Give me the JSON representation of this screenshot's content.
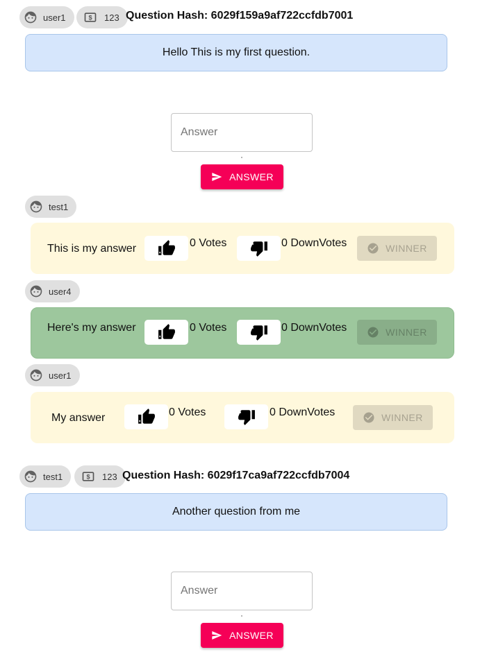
{
  "questions": [
    {
      "user": "user1",
      "dollars": "123",
      "hash": "Question Hash: 6029f159a9af722ccfdb7001",
      "text": "Hello This is my first question.",
      "answer_placeholder": "Answer",
      "answer_button": "ANSWER",
      "answers": [
        {
          "user": "test1",
          "text": "This is my answer",
          "votes": "0 Votes",
          "downvotes": "0 DownVotes",
          "winner": "WINNER",
          "highlighted": false
        },
        {
          "user": "user4",
          "text": "Here's my answer",
          "votes": "0 Votes",
          "downvotes": "0 DownVotes",
          "winner": "WINNER",
          "highlighted": true
        },
        {
          "user": "user1",
          "text": "My answer",
          "votes": "0 Votes",
          "downvotes": "0 DownVotes",
          "winner": "WINNER",
          "highlighted": false
        }
      ]
    },
    {
      "user": "test1",
      "dollars": "123",
      "hash": "Question Hash: 6029f17ca9af722ccfdb7004",
      "text": "Another question from me",
      "answer_placeholder": "Answer",
      "answer_button": "ANSWER",
      "answers": []
    }
  ],
  "icons": {
    "avatar": "face-icon",
    "money": "dollar-box-icon",
    "send": "send-icon",
    "upvote": "thumb-up-icon",
    "downvote": "thumb-down-icon",
    "winner": "check-circle-icon"
  },
  "colors": {
    "question_bg": "#d6e6fc",
    "answer_bg": "#fff8dc",
    "winner_answer_bg": "#9dc79d",
    "accent": "#f50057",
    "chip_bg": "#e0e0e0"
  }
}
